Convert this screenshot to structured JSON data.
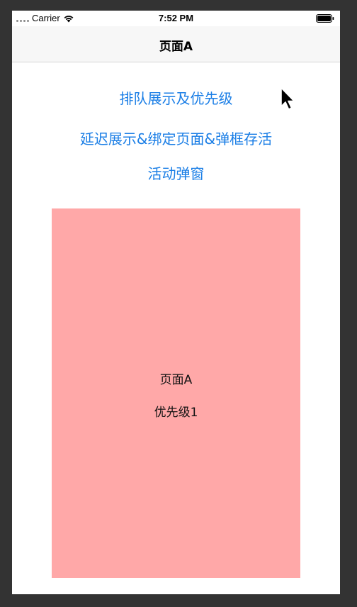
{
  "status_bar": {
    "carrier": "Carrier",
    "time": "7:52 PM"
  },
  "nav": {
    "title": "页面A"
  },
  "buttons": {
    "queue": "排队展示及优先级",
    "delay": "延迟展示&绑定页面&弹框存活",
    "activity": "活动弹窗"
  },
  "popup": {
    "page_label": "页面A",
    "priority_label": "优先级1",
    "background": "#ffa8a8"
  },
  "colors": {
    "link": "#1a7ee6",
    "frame": "#333333",
    "navbar": "#f7f7f7"
  },
  "icons": {
    "wifi": "wifi-icon",
    "battery": "battery-icon",
    "signal": "signal-icon",
    "cursor": "mouse-pointer-icon"
  }
}
